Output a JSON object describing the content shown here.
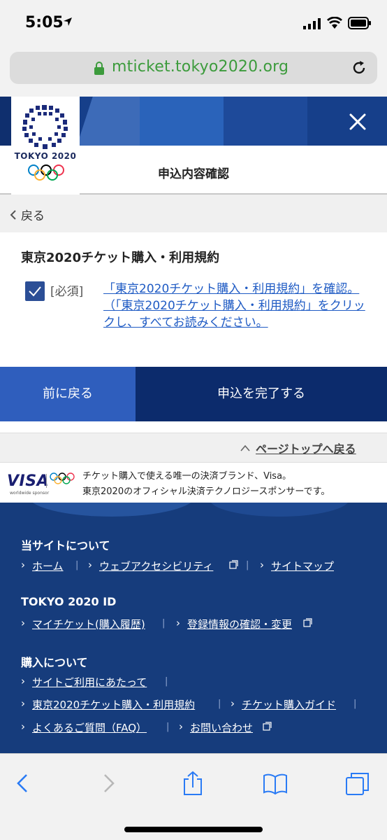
{
  "status_bar": {
    "time": "5:05"
  },
  "browser": {
    "url": "mticket.tokyo2020.org"
  },
  "header": {
    "logo_text": "TOKYO 2020",
    "page_title": "申込内容確認"
  },
  "nav": {
    "back_label": "戻る"
  },
  "terms": {
    "title": "東京2020チケット購入・利用規約",
    "required_label": "[必須]",
    "agreement_link": "「東京2020チケット購入・利用規約」を確認。（「東京2020チケット購入・利用規約」をクリックし、すべてお読みください。",
    "checked": true
  },
  "actions": {
    "back_button": "前に戻る",
    "submit_button": "申込を完了する"
  },
  "page_top": {
    "label": "ページトップへ戻る"
  },
  "visa": {
    "logo": "VISA",
    "sponsor_caption": "worldwide sponsor",
    "line1": "チケット購入で使える唯一の決済ブランド、Visa。",
    "line2": "東京2020のオフィシャル決済テクノロジースポンサーです。"
  },
  "footer": {
    "about": {
      "heading": "当サイトについて",
      "links": [
        "ホーム",
        "ウェブアクセシビリティ",
        "サイトマップ"
      ]
    },
    "tokyo_id": {
      "heading": "TOKYO 2020 ID",
      "links": [
        "マイチケット(購入履歴)",
        "登録情報の確認・変更"
      ]
    },
    "purchase": {
      "heading": "購入について",
      "links": [
        "サイトご利用にあたって",
        "東京2020チケット購入・利用規約",
        "チケット購入ガイド",
        "よくあるご質問（FAQ）",
        "お問い合わせ"
      ]
    }
  },
  "colors": {
    "primary_blue": "#2f5ebd",
    "dark_navy": "#0c2b6c",
    "footer_bg": "#163c7c",
    "link_blue": "#1f5bc4",
    "url_green": "#3c9b3c"
  }
}
